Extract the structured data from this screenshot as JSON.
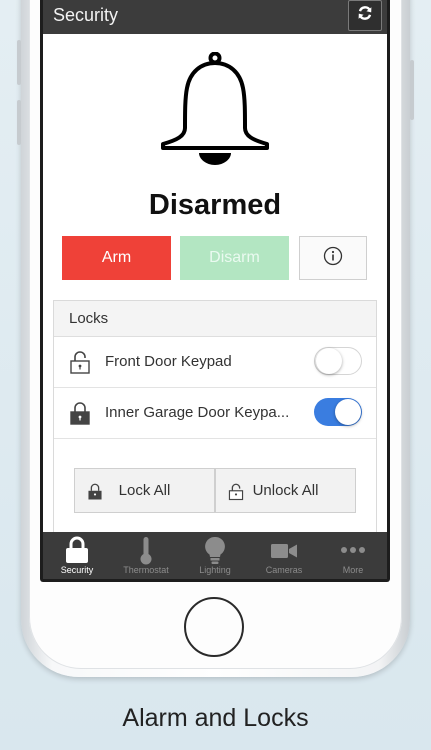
{
  "header": {
    "title": "Security",
    "refresh_icon": "refresh-icon"
  },
  "alarm": {
    "status": "Disarmed",
    "bell_icon": "bell-icon",
    "arm_label": "Arm",
    "disarm_label": "Disarm",
    "info_icon": "info-icon",
    "colors": {
      "arm": "#ef4138",
      "disarm": "#b3e6c2"
    }
  },
  "locks": {
    "heading": "Locks",
    "items": [
      {
        "label": "Front Door Keypad",
        "locked": false,
        "toggle_on": false
      },
      {
        "label": "Inner Garage Door Keypa...",
        "locked": true,
        "toggle_on": true
      }
    ],
    "lock_all_label": "Lock All",
    "unlock_all_label": "Unlock All",
    "toggle_on_color": "#3a7de0"
  },
  "tabs": [
    {
      "label": "Security",
      "icon": "lock-icon",
      "active": true
    },
    {
      "label": "Thermostat",
      "icon": "thermometer-icon",
      "active": false
    },
    {
      "label": "Lighting",
      "icon": "lightbulb-icon",
      "active": false
    },
    {
      "label": "Cameras",
      "icon": "video-camera-icon",
      "active": false
    },
    {
      "label": "More",
      "icon": "more-icon",
      "active": false
    }
  ],
  "caption": "Alarm and Locks"
}
